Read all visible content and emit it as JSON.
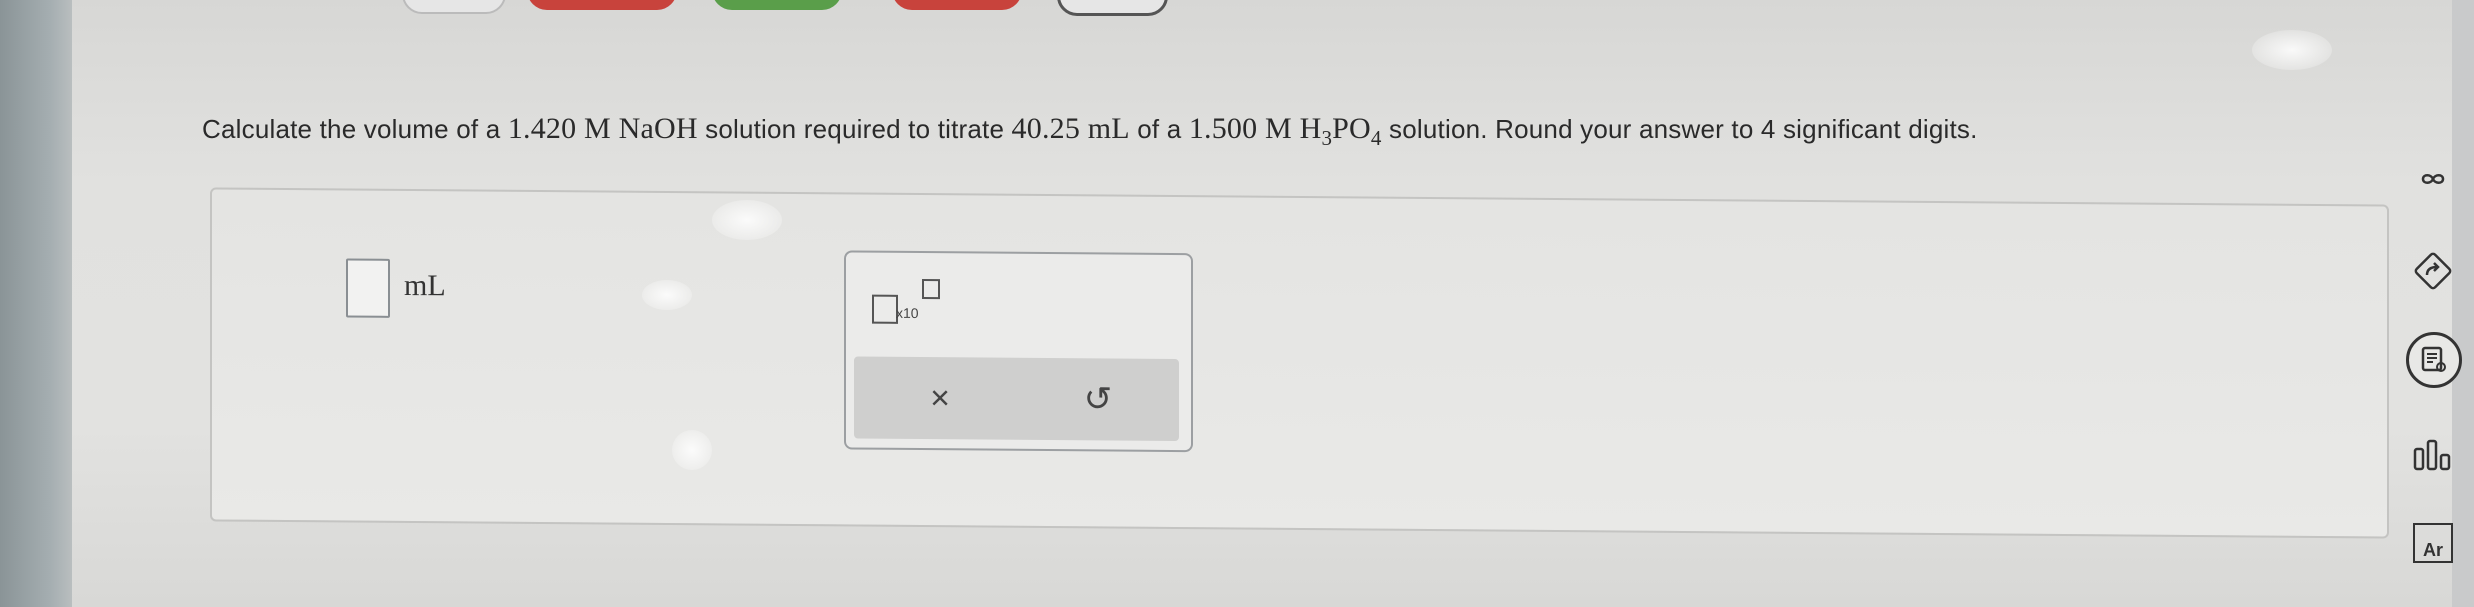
{
  "question": {
    "text_before": "Calculate the volume of a ",
    "naoh_conc": "1.420 M NaOH",
    "text_mid1": " solution required to titrate ",
    "volume": "40.25 mL",
    "text_mid2": " of a ",
    "acid_conc_prefix": "1.500 M H",
    "acid_sub1": "3",
    "acid_mid": "PO",
    "acid_sub2": "4",
    "text_after": " solution. Round your answer to 4 significant digits."
  },
  "answer": {
    "value": "",
    "unit": "mL"
  },
  "keypad": {
    "x10_label": "x10",
    "clear_symbol": "×",
    "undo_symbol": "↺"
  },
  "sidebar": {
    "icons": [
      "infinity-icon",
      "share-arrow-icon",
      "notes-icon",
      "chart-bars-icon",
      "periodic-table-icon"
    ],
    "periodic_label": "Ar"
  }
}
